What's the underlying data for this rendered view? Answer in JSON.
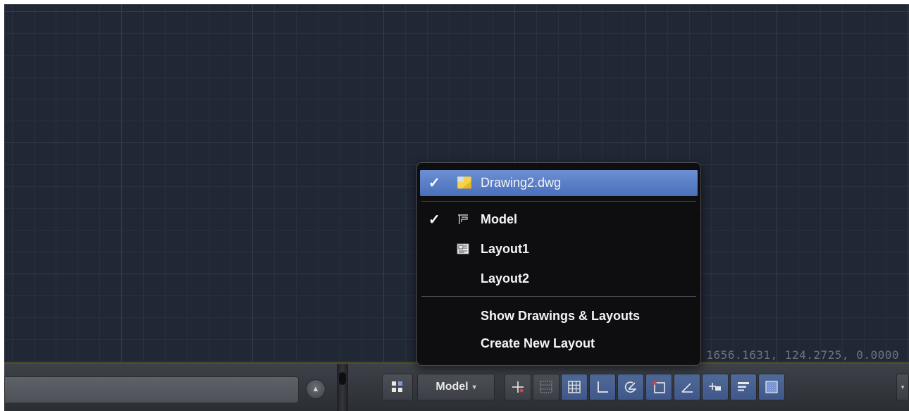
{
  "canvas": {
    "coordinates": "1656.1631, 124.2725, 0.0000"
  },
  "popup_menu": {
    "drawing": {
      "label": "Drawing2.dwg",
      "checked": true,
      "icon": "dwg-file-icon"
    },
    "layouts": [
      {
        "label": "Model",
        "checked": true,
        "icon": "model-space-icon"
      },
      {
        "label": "Layout1",
        "checked": false,
        "icon": "layout-icon"
      },
      {
        "label": "Layout2",
        "checked": false,
        "icon": ""
      }
    ],
    "actions": [
      {
        "label": "Show Drawings & Layouts"
      },
      {
        "label": "Create New Layout"
      }
    ],
    "check_glyph": "✓"
  },
  "statusbar": {
    "command_line_value": "",
    "model_button": {
      "label": "Model",
      "caret": "▾"
    },
    "tools": [
      {
        "icon": "infer-constraints-icon",
        "on": false
      },
      {
        "icon": "snap-mode-icon",
        "on": false
      },
      {
        "icon": "grid-display-icon",
        "on": true
      },
      {
        "icon": "ortho-mode-icon",
        "on": true
      },
      {
        "icon": "polar-tracking-icon",
        "on": true
      },
      {
        "icon": "object-snap-icon",
        "on": true
      },
      {
        "icon": "dynamic-ucs-icon",
        "on": true
      },
      {
        "icon": "dynamic-input-icon",
        "on": true
      },
      {
        "icon": "lineweight-icon",
        "on": true
      },
      {
        "icon": "transparency-icon",
        "on": true
      }
    ]
  },
  "colors": {
    "canvas_bg": "#212835",
    "menu_highlight": "#5a80c8",
    "tool_on": "#4a6290"
  }
}
